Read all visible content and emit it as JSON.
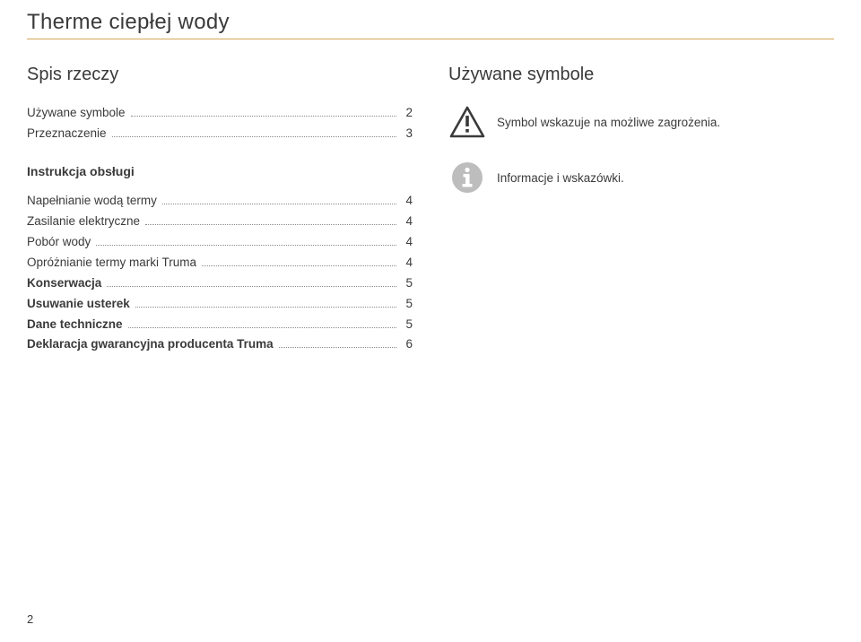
{
  "title": "Therme ciepłej wody",
  "left": {
    "heading": "Spis rzeczy",
    "toc1": [
      {
        "label": "Używane symbole",
        "page": "2",
        "bold": false
      },
      {
        "label": "Przeznaczenie",
        "page": "3",
        "bold": false
      }
    ],
    "subheading": "Instrukcja obsługi",
    "toc2": [
      {
        "label": "Napełnianie wodą termy",
        "page": "4",
        "bold": false
      },
      {
        "label": "Zasilanie elektryczne",
        "page": "4",
        "bold": false
      },
      {
        "label": "Pobór wody",
        "page": "4",
        "bold": false
      },
      {
        "label": "Opróżnianie termy marki Truma",
        "page": "4",
        "bold": false
      },
      {
        "label": "Konserwacja",
        "page": "5",
        "bold": true
      },
      {
        "label": "Usuwanie usterek",
        "page": "5",
        "bold": true
      },
      {
        "label": "Dane techniczne",
        "page": "5",
        "bold": true
      },
      {
        "label": "Deklaracja gwarancyjna producenta Truma",
        "page": "6",
        "bold": true
      }
    ]
  },
  "right": {
    "heading": "Używane symbole",
    "warning_text": "Symbol wskazuje na możliwe zagrożenia.",
    "info_text": "Informacje i wskazówki."
  },
  "page_number": "2"
}
